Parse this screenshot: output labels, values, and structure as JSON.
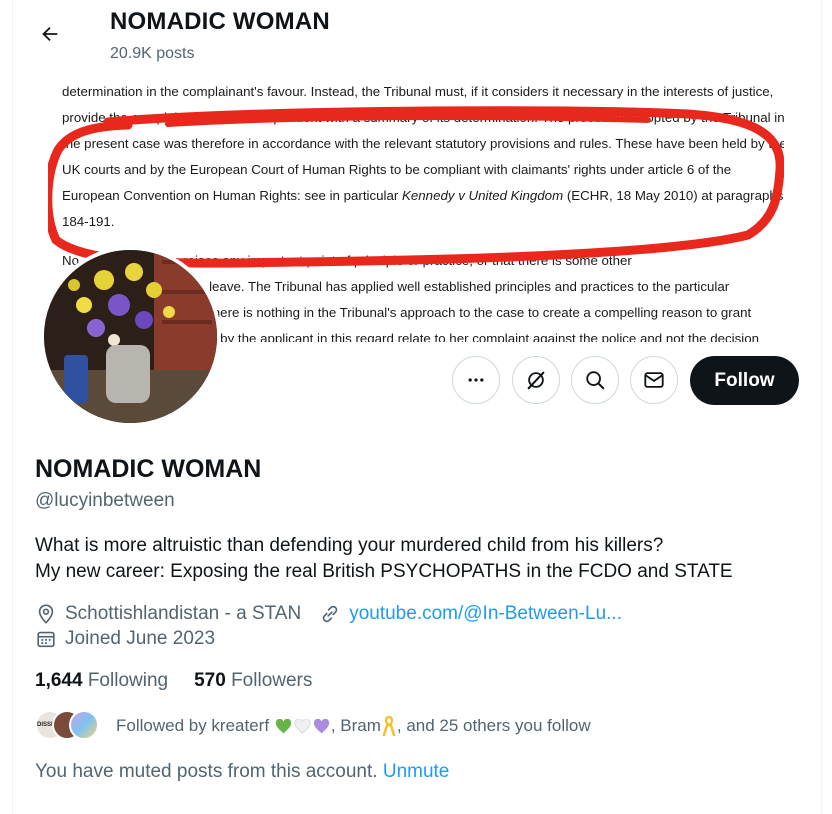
{
  "header": {
    "title": "NOMADIC WOMAN",
    "post_count": "20.9K posts"
  },
  "banner": {
    "lines": [
      "determination in the complainant's favour. Instead, the Tribunal must, if it considers it necessary in the interests of justice,",
      "provide the complainant and the respondent with a summary of its determination. The procedure adopted by the Tribunal in",
      "the present case was therefore in accordance with the relevant statutory provisions and rules. These have been held by the",
      "UK courts and by the European Court of Human Rights to be compliant with claimants' rights under article 6 of the",
      "European Convention on Human Rights: see in particular",
      "Kennedy v United Kingdom",
      "(ECHR, 18 May 2010) at paragraphs",
      "184-191.",
      "No... the application raises any important point of principle or practice, or that there is some other",
      "...leave. The Tribunal has applied well established principles and practices to the particular",
      "...there is nothing in the Tribunal's approach to the case to create a compelling reason to grant",
      "...n by the applicant in this regard relate to her complaint against the police and not the decision"
    ]
  },
  "actions": {
    "more_icon": "more-horizontal-icon",
    "grok_icon": "grok-icon",
    "search_icon": "search-icon",
    "message_icon": "mail-icon",
    "follow_label": "Follow"
  },
  "profile": {
    "name": "NOMADIC WOMAN",
    "handle": "@lucyinbetween",
    "bio_line1": "What is more altruistic than defending your murdered child from his killers?",
    "bio_line2": "My new career: Exposing the real British PSYCHOPATHS in the FCDO and STATE",
    "location": "Schottishlandistan - a STAN",
    "website": "youtube.com/@In-Between-Lu...",
    "joined": "Joined June 2023",
    "following_count": "1,644",
    "following_label": "Following",
    "followers_count": "570",
    "followers_label": "Followers",
    "followed_by_prefix": "Followed by kreaterf",
    "followed_by_mid": ", Bram",
    "followed_by_suffix": ", and 25 others you follow",
    "muted_text": "You have muted posts from this account.",
    "unmute_label": "Unmute",
    "mini_avatar_label": "DISSENT"
  },
  "colors": {
    "accent": "#1d9bf0",
    "follow_bg": "#0f1419",
    "muted_text": "#536471",
    "scribble": "#e8281c"
  }
}
